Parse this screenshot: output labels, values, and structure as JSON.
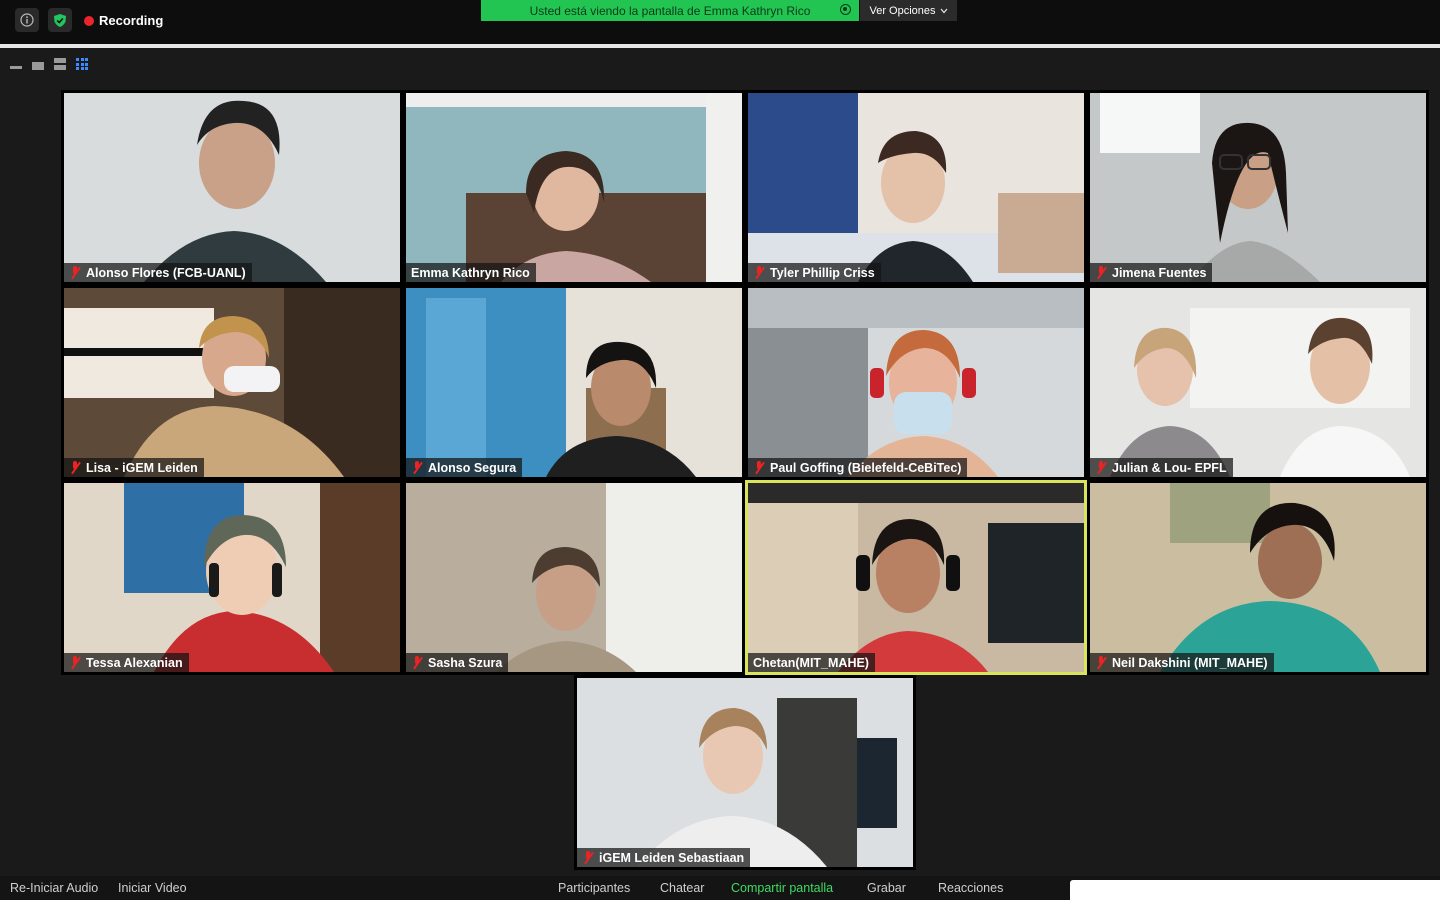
{
  "topbar": {
    "recording_label": "Recording",
    "share_banner": "Usted está viendo la pantalla de Emma Kathryn Rico",
    "view_options": "Ver Opciones",
    "icons": [
      "info-icon",
      "shield-check-icon",
      "recording-dot-icon",
      "chevron-down-icon"
    ]
  },
  "layout_icons": [
    "minimize-view-icon",
    "speaker-view-icon",
    "strip-view-icon",
    "gallery-view-icon"
  ],
  "participants": [
    {
      "name": "Alonso Flores (FCB-UANL)",
      "muted": true,
      "active": false
    },
    {
      "name": "Emma Kathryn Rico",
      "muted": false,
      "active": false
    },
    {
      "name": "Tyler Phillip Criss",
      "muted": true,
      "active": false
    },
    {
      "name": "Jimena Fuentes",
      "muted": true,
      "active": false
    },
    {
      "name": "Lisa - iGEM Leiden",
      "muted": true,
      "active": false
    },
    {
      "name": "Alonso Segura",
      "muted": true,
      "active": false
    },
    {
      "name": "Paul Goffing (Bielefeld-CeBiTec)",
      "muted": true,
      "active": false
    },
    {
      "name": "Julian & Lou- EPFL",
      "muted": true,
      "active": false
    },
    {
      "name": "Tessa Alexanian",
      "muted": true,
      "active": false
    },
    {
      "name": "Sasha Szura",
      "muted": true,
      "active": false
    },
    {
      "name": "Chetan(MIT_MAHE)",
      "muted": false,
      "active": true
    },
    {
      "name": "Neil Dakshini (MIT_MAHE)",
      "muted": true,
      "active": false
    },
    {
      "name": "iGEM Leiden Sebastiaan",
      "muted": true,
      "active": false
    }
  ],
  "bottombar": {
    "audio": "Re-Iniciar Audio",
    "video": "Iniciar Video",
    "participants": "Participantes",
    "chat": "Chatear",
    "share": "Compartir pantalla",
    "record": "Grabar",
    "reactions": "Reacciones"
  },
  "colors": {
    "banner_green": "#23c552",
    "active_speaker": "#d9e35c",
    "share_green": "#3ddc62",
    "mute_red": "#e22222"
  }
}
